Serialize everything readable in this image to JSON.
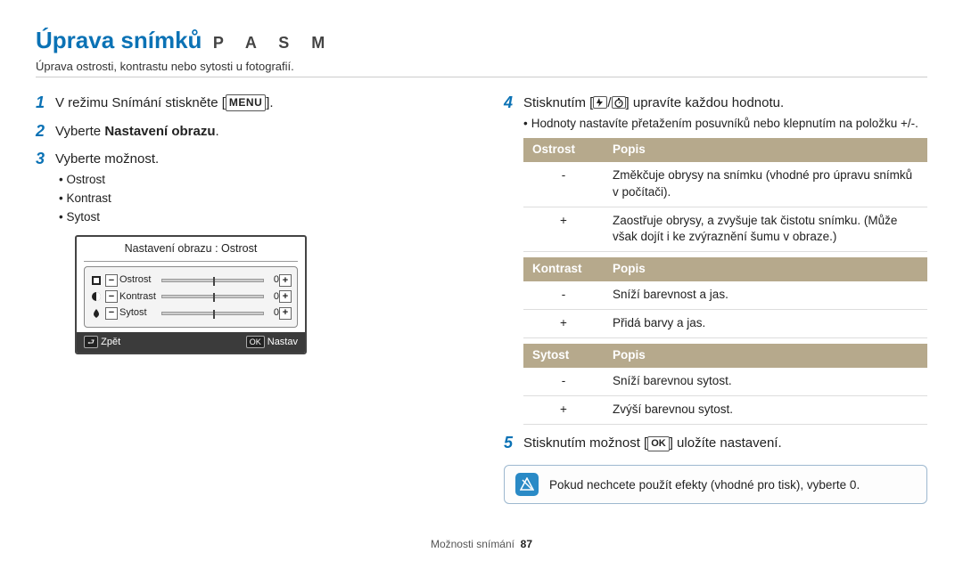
{
  "header": {
    "title": "Úprava snímků",
    "modes": "P A S M",
    "subtitle": "Úprava ostrosti, kontrastu nebo sytosti u fotografií."
  },
  "left": {
    "step1_prefix": "V režimu Snímání stiskněte [",
    "step1_menu": "MENU",
    "step1_suffix": "].",
    "step2_prefix": "Vyberte ",
    "step2_bold": "Nastavení obrazu",
    "step2_suffix": ".",
    "step3": "Vyberte možnost.",
    "bullets": [
      "Ostrost",
      "Kontrast",
      "Sytost"
    ],
    "device": {
      "title": "Nastavení obrazu : Ostrost",
      "rows": [
        {
          "label": "Ostrost",
          "value": "0"
        },
        {
          "label": "Kontrast",
          "value": "0"
        },
        {
          "label": "Sytost",
          "value": "0"
        }
      ],
      "back_label": "Zpět",
      "ok_label": "Nastav",
      "back_icon": "⮐",
      "ok_icon": "OK"
    }
  },
  "right": {
    "step4_prefix": "Stisknutím [",
    "step4_mid": "/",
    "step4_suffix": "] upravíte každou hodnotu.",
    "step4_bullet": "Hodnoty nastavíte přetažením posuvníků nebo klepnutím na položku +/-.",
    "tables": [
      {
        "head": [
          "Ostrost",
          "Popis"
        ],
        "rows": [
          {
            "sign": "-",
            "text": "Změkčuje obrysy na snímku (vhodné pro úpravu snímků v počítači)."
          },
          {
            "sign": "+",
            "text": "Zaostřuje obrysy, a zvyšuje tak čistotu snímku. (Může však dojít i ke zvýraznění šumu v obraze.)"
          }
        ]
      },
      {
        "head": [
          "Kontrast",
          "Popis"
        ],
        "rows": [
          {
            "sign": "-",
            "text": "Sníží barevnost a jas."
          },
          {
            "sign": "+",
            "text": "Přidá barvy a jas."
          }
        ]
      },
      {
        "head": [
          "Sytost",
          "Popis"
        ],
        "rows": [
          {
            "sign": "-",
            "text": "Sníží barevnou sytost."
          },
          {
            "sign": "+",
            "text": "Zvýší barevnou sytost."
          }
        ]
      }
    ],
    "step5_prefix": "Stisknutím možnost [",
    "step5_ok": "OK",
    "step5_suffix": "] uložíte nastavení.",
    "note": "Pokud nechcete použít efekty (vhodné pro tisk), vyberte 0."
  },
  "footer": {
    "label": "Možnosti snímání",
    "page": "87"
  }
}
